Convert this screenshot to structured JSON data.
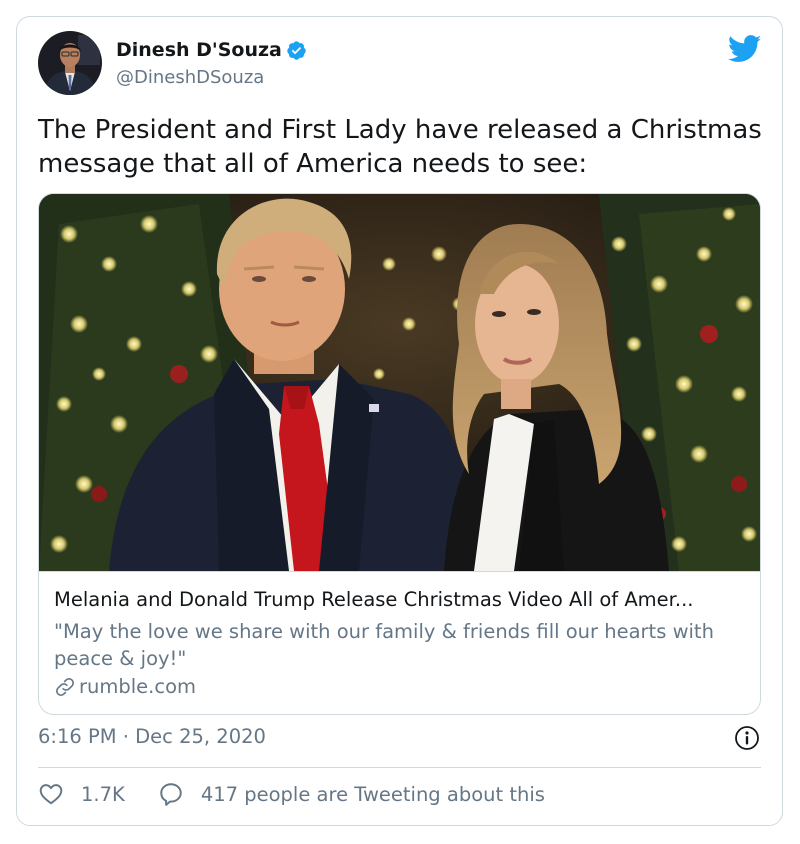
{
  "author": {
    "name": "Dinesh D'Souza",
    "handle": "@DineshDSouza",
    "verified": true
  },
  "tweet": {
    "text": "The President and First Lady have released a Christmas message that all of America needs to see:"
  },
  "link_card": {
    "title": "Melania and Donald Trump Release Christmas Video All of Amer...",
    "description": "\"May the love we share with our family & friends fill our hearts with peace & joy!\"",
    "domain": "rumble.com"
  },
  "meta": {
    "timestamp": "6:16 PM · Dec 25, 2020"
  },
  "actions": {
    "likes": "1.7K",
    "talking": "417 people are Tweeting about this"
  },
  "colors": {
    "twitter_blue": "#1da1f2",
    "text_primary": "#14171a",
    "text_secondary": "#657786",
    "border": "#cfd9de"
  },
  "icons": [
    "verified-badge-icon",
    "twitter-bird-icon",
    "link-icon",
    "info-icon",
    "heart-icon",
    "reply-bubble-icon"
  ]
}
